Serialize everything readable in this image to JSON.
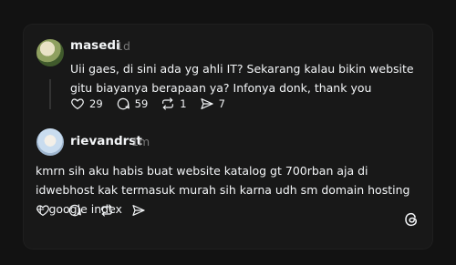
{
  "post": {
    "username": "masedi",
    "time": "1d",
    "text": "Uii gaes, di sini ada yg ahli IT? Sekarang kalau bikin website gitu biayanya berapaan ya? Infonya donk, thank you",
    "likes": "29",
    "comments": "59",
    "reposts": "1",
    "shares": "7"
  },
  "reply": {
    "username": "rievandrst",
    "time": "1m",
    "text": "kmrn sih aku habis buat website katalog gt 700rban aja di idwebhost kak termasuk murah sih karna udh sm domain hosting + google index"
  },
  "icons": {
    "like": "heart-icon",
    "comment": "comment-icon",
    "repost": "repost-icon",
    "share": "share-icon",
    "logo": "threads-logo-icon"
  }
}
